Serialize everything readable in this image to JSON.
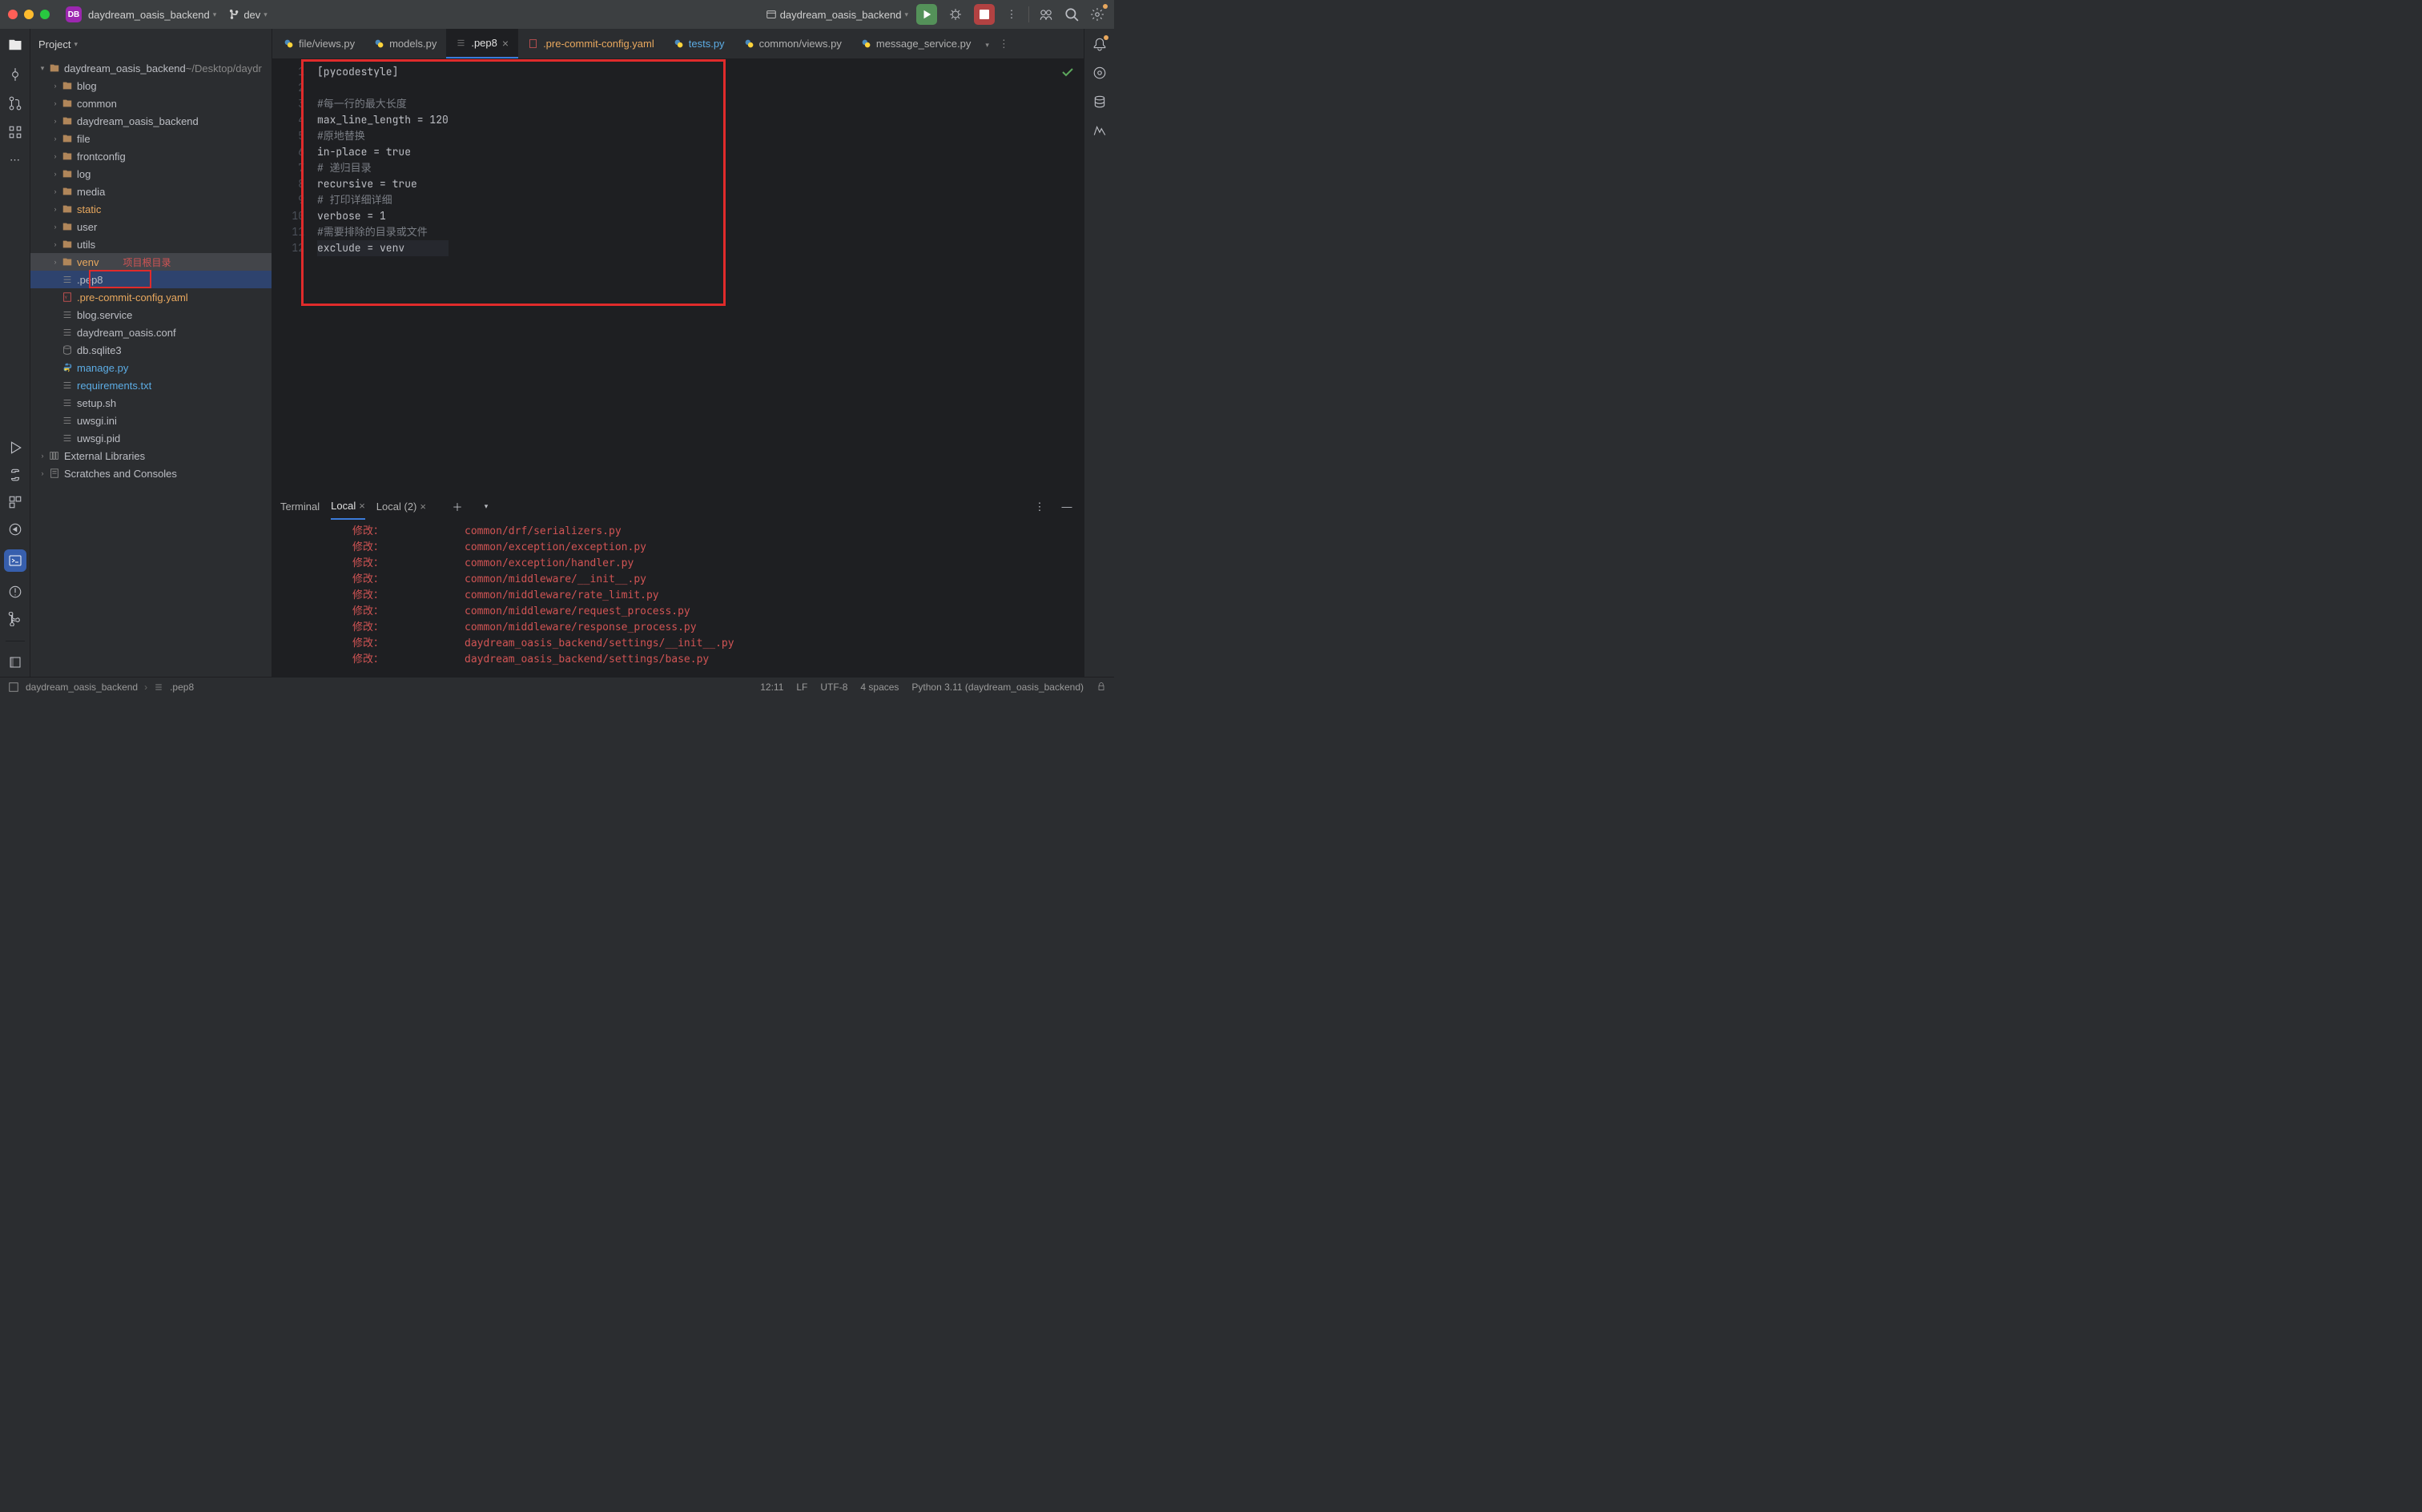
{
  "titlebar": {
    "badge": "DB",
    "project_name": "daydream_oasis_backend",
    "branch_icon": "git-branch",
    "branch": "dev",
    "run_config": "daydream_oasis_backend"
  },
  "sidebar": {
    "title": "Project",
    "root_name": "daydream_oasis_backend",
    "root_path": "~/Desktop/daydr",
    "folders": [
      {
        "name": "blog",
        "depth": 1,
        "color": "default"
      },
      {
        "name": "common",
        "depth": 1,
        "color": "default"
      },
      {
        "name": "daydream_oasis_backend",
        "depth": 1,
        "color": "default"
      },
      {
        "name": "file",
        "depth": 1,
        "color": "default"
      },
      {
        "name": "frontconfig",
        "depth": 1,
        "color": "default"
      },
      {
        "name": "log",
        "depth": 1,
        "color": "default"
      },
      {
        "name": "media",
        "depth": 1,
        "color": "default"
      },
      {
        "name": "static",
        "depth": 1,
        "color": "orange"
      },
      {
        "name": "user",
        "depth": 1,
        "color": "default"
      },
      {
        "name": "utils",
        "depth": 1,
        "color": "default"
      },
      {
        "name": "venv",
        "depth": 1,
        "color": "orange",
        "highlight": true,
        "annotation": "项目根目录"
      }
    ],
    "files": [
      {
        "name": ".pep8",
        "depth": 1,
        "selected": true,
        "icon": "text",
        "boxed": true
      },
      {
        "name": ".pre-commit-config.yaml",
        "depth": 1,
        "icon": "yaml",
        "color": "orange"
      },
      {
        "name": "blog.service",
        "depth": 1,
        "icon": "text"
      },
      {
        "name": "daydream_oasis.conf",
        "depth": 1,
        "icon": "text"
      },
      {
        "name": "db.sqlite3",
        "depth": 1,
        "icon": "db"
      },
      {
        "name": "manage.py",
        "depth": 1,
        "icon": "py",
        "color": "blue"
      },
      {
        "name": "requirements.txt",
        "depth": 1,
        "icon": "text",
        "color": "blue"
      },
      {
        "name": "setup.sh",
        "depth": 1,
        "icon": "text"
      },
      {
        "name": "uwsgi.ini",
        "depth": 1,
        "icon": "text"
      },
      {
        "name": "uwsgi.pid",
        "depth": 1,
        "icon": "text"
      }
    ],
    "extras": [
      {
        "name": "External Libraries",
        "icon": "lib"
      },
      {
        "name": "Scratches and Consoles",
        "icon": "scratch"
      }
    ]
  },
  "tabs": [
    {
      "label": "file/views.py",
      "icon": "py"
    },
    {
      "label": "models.py",
      "icon": "py"
    },
    {
      "label": ".pep8",
      "icon": "text",
      "active": true,
      "closeable": true
    },
    {
      "label": ".pre-commit-config.yaml",
      "icon": "yaml",
      "color": "orange"
    },
    {
      "label": "tests.py",
      "icon": "py",
      "color": "blue"
    },
    {
      "label": "common/views.py",
      "icon": "py"
    },
    {
      "label": "message_service.py",
      "icon": "py"
    }
  ],
  "editor": {
    "lines": [
      {
        "n": 1,
        "text": "[pycodestyle]"
      },
      {
        "n": 2,
        "text": ""
      },
      {
        "n": 3,
        "text": "#每一行的最大长度",
        "comment": true
      },
      {
        "n": 4,
        "text": "max_line_length = 120"
      },
      {
        "n": 5,
        "text": "#原地替换",
        "comment": true
      },
      {
        "n": 6,
        "text": "in-place = true"
      },
      {
        "n": 7,
        "text": "# 递归目录",
        "comment": true
      },
      {
        "n": 8,
        "text": "recursive = true"
      },
      {
        "n": 9,
        "text": "# 打印详细详细",
        "comment": true
      },
      {
        "n": 10,
        "text": "verbose = 1"
      },
      {
        "n": 11,
        "text": "#需要排除的目录或文件",
        "comment": true
      },
      {
        "n": 12,
        "text": "exclude = venv",
        "cursor": true
      }
    ]
  },
  "terminal": {
    "title": "Terminal",
    "tabs": [
      {
        "label": "Local",
        "active": true,
        "closeable": true
      },
      {
        "label": "Local (2)",
        "closeable": true
      }
    ],
    "lines": [
      {
        "label": "修改：",
        "path": "common/drf/serializers.py"
      },
      {
        "label": "修改：",
        "path": "common/exception/exception.py"
      },
      {
        "label": "修改：",
        "path": "common/exception/handler.py"
      },
      {
        "label": "修改：",
        "path": "common/middleware/__init__.py"
      },
      {
        "label": "修改：",
        "path": "common/middleware/rate_limit.py"
      },
      {
        "label": "修改：",
        "path": "common/middleware/request_process.py"
      },
      {
        "label": "修改：",
        "path": "common/middleware/response_process.py"
      },
      {
        "label": "修改：",
        "path": "daydream_oasis_backend/settings/__init__.py"
      },
      {
        "label": "修改：",
        "path": "daydream_oasis_backend/settings/base.py"
      }
    ]
  },
  "statusbar": {
    "breadcrumb_root": "daydream_oasis_backend",
    "breadcrumb_file": ".pep8",
    "caret": "12:11",
    "line_sep": "LF",
    "encoding": "UTF-8",
    "indent": "4 spaces",
    "python": "Python 3.11 (daydream_oasis_backend)"
  }
}
